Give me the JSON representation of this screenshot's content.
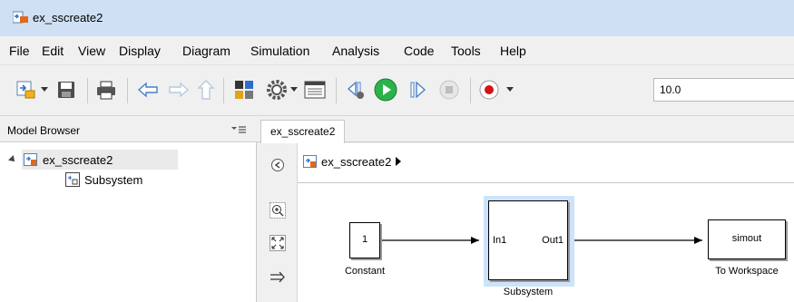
{
  "window": {
    "title": "ex_sscreate2"
  },
  "menu": [
    "File",
    "Edit",
    "View",
    "Display",
    "Diagram",
    "Simulation",
    "Analysis",
    "Code",
    "Tools",
    "Help"
  ],
  "toolbar": {
    "stop_time": "10.0",
    "icons": [
      "new-model-icon",
      "save-icon",
      "print-icon",
      "back-icon",
      "forward-icon",
      "up-icon",
      "library-browser-icon",
      "settings-icon",
      "model-explorer-icon",
      "step-back-icon",
      "run-icon",
      "step-forward-icon",
      "stop-icon",
      "record-icon"
    ]
  },
  "model_browser": {
    "title": "Model Browser",
    "tree": [
      {
        "label": "ex_sscreate2",
        "selected": true
      },
      {
        "label": "Subsystem",
        "selected": false
      }
    ]
  },
  "tab": {
    "label": "ex_sscreate2"
  },
  "address": {
    "crumb": "ex_sscreate2"
  },
  "diagram": {
    "constant": {
      "value": "1",
      "label": "Constant"
    },
    "subsystem": {
      "in_port": "In1",
      "out_port": "Out1",
      "label": "Subsystem"
    },
    "to_workspace": {
      "var": "simout",
      "label": "To Workspace"
    }
  },
  "colors": {
    "titlebar": "#cfe0f4",
    "run_green": "#2bb34a",
    "record_red": "#d21414",
    "selection_blue": "#cce3fa"
  }
}
